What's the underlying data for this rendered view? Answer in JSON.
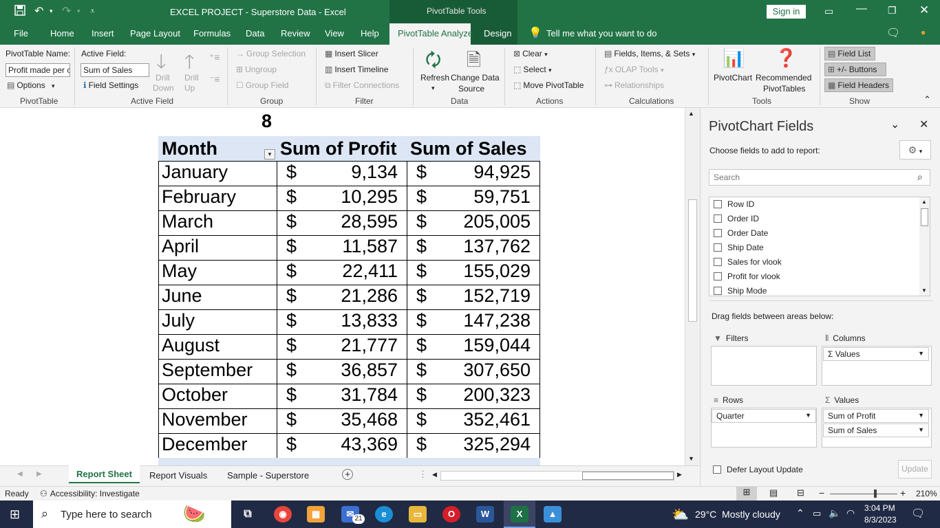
{
  "titlebar": {
    "title": "EXCEL PROJECT - Superstore Data  -  Excel",
    "context_group": "PivotTable Tools",
    "sign_in": "Sign in",
    "icons": [
      "save-icon",
      "undo-icon",
      "redo-icon",
      "customize-icon",
      "ribbon-display-icon",
      "minimize-icon",
      "restore-icon",
      "close-icon"
    ]
  },
  "tabs": [
    "File",
    "Home",
    "Insert",
    "Page Layout",
    "Formulas",
    "Data",
    "Review",
    "View",
    "Help",
    "PivotTable Analyze",
    "Design"
  ],
  "active_tab": "PivotTable Analyze",
  "tell_me": "Tell me what you want to do",
  "ribbon": {
    "pivottable": {
      "name_label": "PivotTable Name:",
      "name_value": "Profit made per c",
      "options": "Options",
      "group": "PivotTable"
    },
    "active_field": {
      "label": "Active Field:",
      "value": "Sum of Sales",
      "field_settings": "Field Settings",
      "drill_down": [
        "Drill",
        "Down"
      ],
      "drill_up": [
        "Drill",
        "Up"
      ],
      "group": "Active Field"
    },
    "group": {
      "group_selection": "Group Selection",
      "ungroup": "Ungroup",
      "group_field": "Group Field",
      "group": "Group"
    },
    "filter": {
      "insert_slicer": "Insert Slicer",
      "insert_timeline": "Insert Timeline",
      "filter_connections": "Filter Connections",
      "group": "Filter"
    },
    "data": {
      "refresh": "Refresh",
      "change": [
        "Change Data",
        "Source"
      ],
      "group": "Data"
    },
    "actions": {
      "clear": "Clear",
      "select": "Select",
      "move": "Move PivotTable",
      "group": "Actions"
    },
    "calculations": {
      "fields": "Fields, Items, & Sets",
      "olap": "OLAP Tools",
      "relationships": "Relationships",
      "group": "Calculations"
    },
    "tools": {
      "pivotchart": "PivotChart",
      "recommended": [
        "Recommended",
        "PivotTables"
      ],
      "group": "Tools"
    },
    "show": {
      "field_list": "Field List",
      "buttons": "+/- Buttons",
      "field_headers": "Field Headers",
      "group": "Show"
    }
  },
  "sheet": {
    "quarter": "8",
    "headers": [
      "Month",
      "Sum of Profit",
      "Sum of Sales"
    ],
    "rows": [
      {
        "month": "January",
        "profit": "9,134",
        "sales": "94,925"
      },
      {
        "month": "February",
        "profit": "10,295",
        "sales": "59,751"
      },
      {
        "month": "March",
        "profit": "28,595",
        "sales": "205,005"
      },
      {
        "month": "April",
        "profit": "11,587",
        "sales": "137,762"
      },
      {
        "month": "May",
        "profit": "22,411",
        "sales": "155,029"
      },
      {
        "month": "June",
        "profit": "21,286",
        "sales": "152,719"
      },
      {
        "month": "July",
        "profit": "13,833",
        "sales": "147,238"
      },
      {
        "month": "August",
        "profit": "21,777",
        "sales": "159,044"
      },
      {
        "month": "September",
        "profit": "36,857",
        "sales": "307,650"
      },
      {
        "month": "October",
        "profit": "31,784",
        "sales": "200,323"
      },
      {
        "month": "November",
        "profit": "35,468",
        "sales": "352,461"
      },
      {
        "month": "December",
        "profit": "43,369",
        "sales": "325,294"
      }
    ],
    "currency": "$"
  },
  "panel": {
    "title": "PivotChart Fields",
    "choose": "Choose fields to add to report:",
    "search_placeholder": "Search",
    "fields": [
      "Row ID",
      "Order ID",
      "Order Date",
      "Ship Date",
      "Sales for vlook",
      "Profit for vlook",
      "Ship Mode"
    ],
    "drag": "Drag fields between areas below:",
    "filters": "Filters",
    "columns": "Columns",
    "columns_items": [
      "Values"
    ],
    "rows": "Rows",
    "rows_items": [
      "Quarter"
    ],
    "values": "Values",
    "values_items": [
      "Sum of Profit",
      "Sum of Sales"
    ],
    "defer": "Defer Layout Update",
    "update": "Update"
  },
  "sheet_tabs": [
    "Report Sheet",
    "Report Visuals",
    "Sample - Superstore"
  ],
  "active_sheet": "Report Sheet",
  "status": {
    "ready": "Ready",
    "accessibility": "Accessibility: Investigate",
    "zoom": "210%"
  },
  "taskbar": {
    "search_placeholder": "Type here to search",
    "weather": "29°C  Mostly cloudy",
    "time": "3:04 PM",
    "date": "8/3/2023",
    "mail_badge": "21"
  }
}
